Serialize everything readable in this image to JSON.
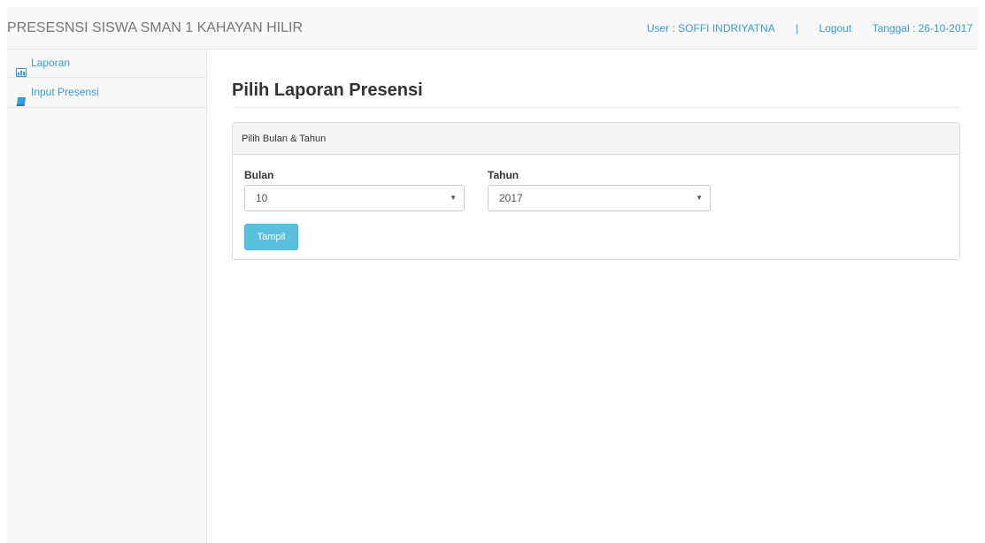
{
  "navbar": {
    "brand": "PRESESNSI SISWA SMAN 1 KAHAYAN HILIR",
    "user": "User : SOFFI INDRIYATNA",
    "separator": "|",
    "logout": "Logout",
    "date": "Tanggal : 26-10-2017"
  },
  "sidebar": {
    "items": [
      {
        "label": "Laporan",
        "icon": "chart-icon"
      },
      {
        "label": "Input Presensi",
        "icon": "book-icon"
      }
    ]
  },
  "main": {
    "title": "Pilih Laporan Presensi",
    "panel": {
      "heading": "Pilih Bulan & Tahun",
      "month_label": "Bulan",
      "month_value": "10",
      "year_label": "Tahun",
      "year_value": "2017",
      "button_label": "Tampil"
    }
  },
  "colors": {
    "link": "#3a9bd9",
    "button": "#5bc0de",
    "navbar_bg": "#f8f8f8"
  }
}
